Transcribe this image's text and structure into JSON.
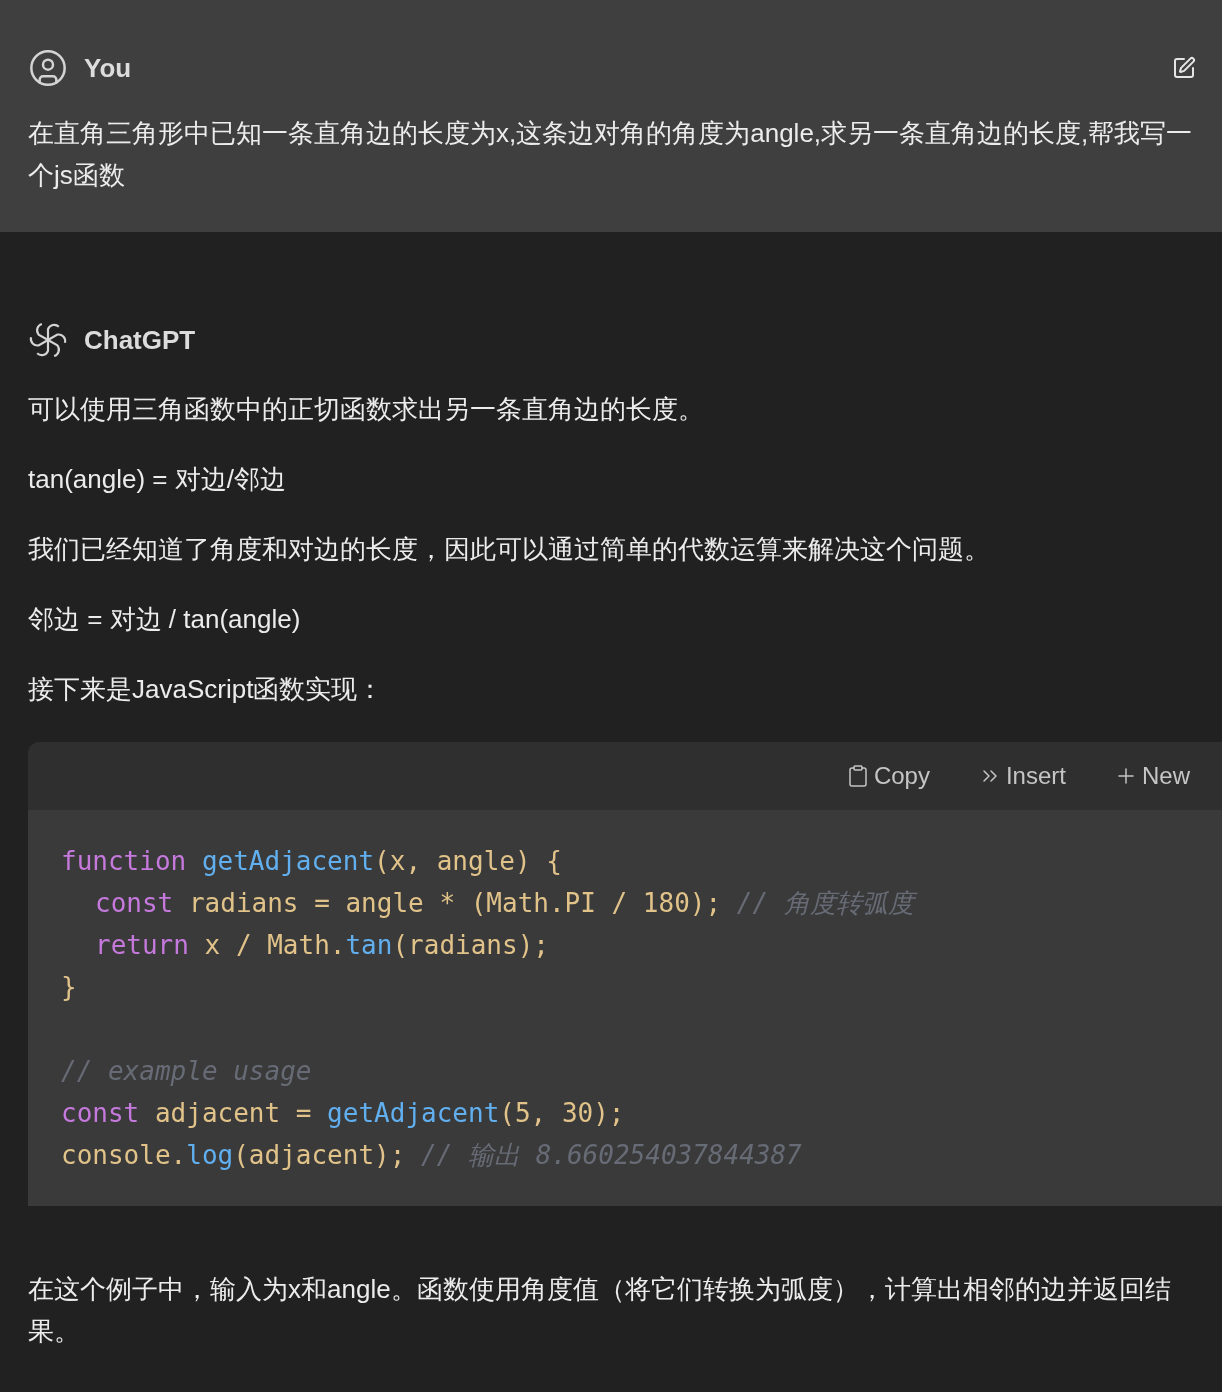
{
  "user_message": {
    "author": "You",
    "text": "在直角三角形中已知一条直角边的长度为x,这条边对角的角度为angle,求另一条直角边的长度,帮我写一个js函数"
  },
  "assistant_message": {
    "author": "ChatGPT",
    "paragraphs_before": [
      "可以使用三角函数中的正切函数求出另一条直角边的长度。",
      "tan(angle) = 对边/邻边",
      "我们已经知道了角度和对边的长度，因此可以通过简单的代数运算来解决这个问题。",
      "邻边 = 对边 / tan(angle)",
      "接下来是JavaScript函数实现："
    ],
    "code_block": {
      "actions": [
        {
          "kind": "copy",
          "label": "Copy"
        },
        {
          "kind": "insert",
          "label": "Insert"
        },
        {
          "kind": "new",
          "label": "New"
        }
      ],
      "blocks": [
        {
          "lines": [
            {
              "tokens": [
                {
                  "kind": "keyword",
                  "text": "function "
                },
                {
                  "kind": "function",
                  "text": "getAdjacent"
                },
                {
                  "kind": "plain",
                  "text": "(x, angle) {"
                }
              ],
              "children": [
                {
                  "tokens": [
                    {
                      "kind": "keyword",
                      "text": "const "
                    },
                    {
                      "kind": "plain",
                      "text": "radians = angle * (Math.PI / 180); "
                    },
                    {
                      "kind": "comment",
                      "text": "// 角度转弧度"
                    }
                  ]
                },
                {
                  "tokens": [
                    {
                      "kind": "keyword",
                      "text": "return "
                    },
                    {
                      "kind": "plain",
                      "text": "x / Math."
                    },
                    {
                      "kind": "function",
                      "text": "tan"
                    },
                    {
                      "kind": "plain",
                      "text": "(radians);"
                    }
                  ]
                }
              ]
            },
            {
              "tokens": [
                {
                  "kind": "plain",
                  "text": "}"
                }
              ]
            }
          ]
        },
        {
          "lines": [
            {
              "tokens": [
                {
                  "kind": "comment",
                  "text": "// example usage"
                }
              ]
            },
            {
              "tokens": [
                {
                  "kind": "keyword",
                  "text": "const "
                },
                {
                  "kind": "plain",
                  "text": "adjacent = "
                },
                {
                  "kind": "function",
                  "text": "getAdjacent"
                },
                {
                  "kind": "plain",
                  "text": "(5, 30);"
                }
              ]
            },
            {
              "tokens": [
                {
                  "kind": "plain",
                  "text": "console."
                },
                {
                  "kind": "function",
                  "text": "log"
                },
                {
                  "kind": "plain",
                  "text": "(adjacent); "
                },
                {
                  "kind": "comment",
                  "text": "// 输出 8.660254037844387"
                }
              ]
            }
          ]
        }
      ]
    },
    "paragraphs_after": [
      "在这个例子中，输入为x和angle。函数使用角度值（将它们转换为弧度），计算出相邻的边并返回结果。"
    ]
  }
}
